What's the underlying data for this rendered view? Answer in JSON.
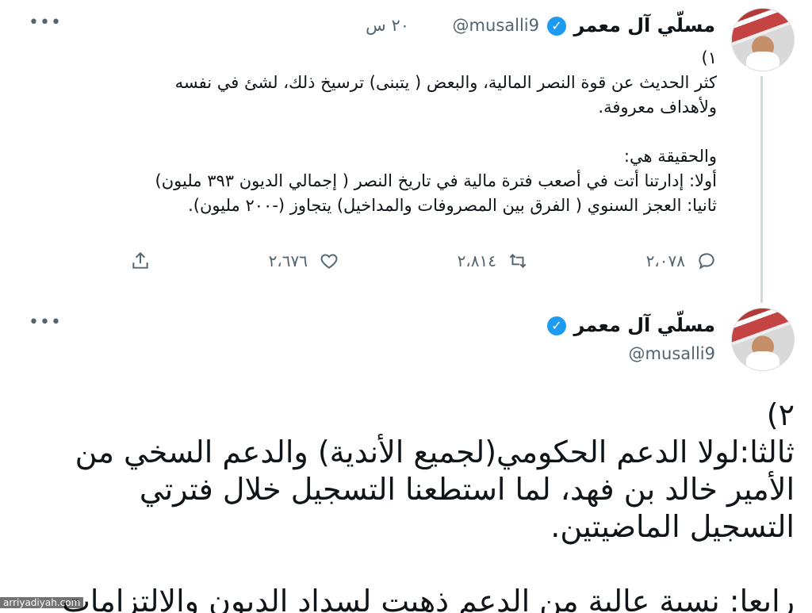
{
  "tweet1": {
    "name": "مسلّي آل معمر",
    "handle": "@musalli9",
    "time": "٢٠ س",
    "number": "١)",
    "body": [
      "كثر الحديث عن قوة النصر المالية، والبعض ( يتبنى) ترسيخ ذلك، لشئ في نفسه",
      "ولأهداف معروفة.",
      "",
      "والحقيقة هي:",
      "أولا: إدارتنا أتت في أصعب فترة مالية في تاريخ النصر ( إجمالي الديون ٣٩٣ مليون)",
      "ثانيا: العجز السنوي ( الفرق بين المصروفات والمداخيل) يتجاوز (-٢٠٠ مليون)."
    ],
    "actions": {
      "replies": "٢،٠٧٨",
      "retweets": "٢،٨١٤",
      "likes": "٢،٦٧٦"
    }
  },
  "tweet2": {
    "name": "مسلّي آل معمر",
    "handle": "@musalli9",
    "body": [
      "٢)",
      "ثالثا:لولا الدعم الحكومي(لجميع الأندية) والدعم السخي من",
      "الأمير خالد بن فهد، لما استطعنا التسجيل خلال فترتي",
      "التسجيل الماضيتين.",
      "",
      "رابعا: نسبة عالية من الدعم ذهبت لسداد الديون والالتزامات"
    ]
  },
  "watermark": "arriyadiyah.com",
  "colors": {
    "verified": "#1d9bf0",
    "muted": "#536471",
    "thread_line": "#cfd9de"
  },
  "icons": [
    "more-icon",
    "verified-badge-icon",
    "reply-icon",
    "retweet-icon",
    "like-icon",
    "share-icon"
  ]
}
